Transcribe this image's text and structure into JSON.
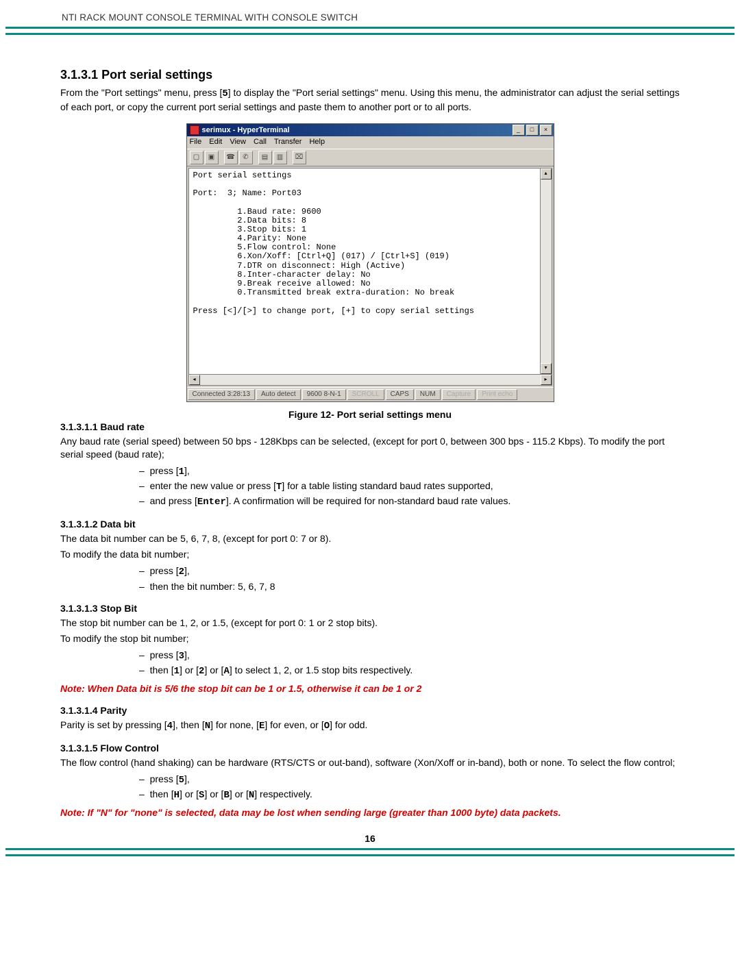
{
  "header": {
    "title": "NTI RACK MOUNT CONSOLE TERMINAL WITH CONSOLE SWITCH"
  },
  "section": {
    "number": "3.1.3.1",
    "title": "Port serial settings",
    "intro_part1": "From the \"Port settings\" menu, press [",
    "intro_key": "5",
    "intro_part2": "] to display the \"Port serial settings\" menu. Using this menu, the administrator can adjust the serial settings of each port, or copy the current port serial settings and paste them to another port or to all ports."
  },
  "hyperterminal": {
    "title": "serimux - HyperTerminal",
    "menubar": [
      "File",
      "Edit",
      "View",
      "Call",
      "Transfer",
      "Help"
    ],
    "terminal_text": "Port serial settings\n\nPort:  3; Name: Port03\n\n         1.Baud rate: 9600\n         2.Data bits: 8\n         3.Stop bits: 1\n         4.Parity: None\n         5.Flow control: None\n         6.Xon/Xoff: [Ctrl+Q] (017) / [Ctrl+S] (019)\n         7.DTR on disconnect: High (Active)\n         8.Inter-character delay: No\n         9.Break receive allowed: No\n         0.Transmitted break extra-duration: No break\n\nPress [<]/[>] to change port, [+] to copy serial settings",
    "status": {
      "connected": "Connected 3:28:13",
      "auto": "Auto detect",
      "settings": "9600 8-N-1",
      "scroll": "SCROLL",
      "caps": "CAPS",
      "num": "NUM",
      "capture": "Capture",
      "printecho": "Print echo"
    }
  },
  "figure_caption": "Figure 12- Port serial settings menu",
  "baud": {
    "heading": "3.1.3.1.1 Baud rate",
    "p1": "Any baud rate (serial speed) between 50 bps - 128Kbps can be selected, (except for port 0,  between 300 bps - 115.2 Kbps). To modify the port serial speed (baud rate);",
    "li1a": "press [",
    "li1key": "1",
    "li1b": "],",
    "li2a": "enter the new value or press [",
    "li2key": "T",
    "li2b": "] for a table listing standard baud rates supported,",
    "li3a": "and press [",
    "li3key": "Enter",
    "li3b": "].    A confirmation will be required for non-standard baud rate values."
  },
  "databit": {
    "heading": "3.1.3.1.2 Data bit",
    "p1": "The data bit number can be 5, 6, 7, 8, (except for port 0:  7 or 8).",
    "p2": "To modify the data bit number;",
    "li1a": "press [",
    "li1key": "2",
    "li1b": "],",
    "li2": "then the bit number: 5, 6, 7, 8"
  },
  "stopbit": {
    "heading": "3.1.3.1.3 Stop Bit",
    "p1": "The stop bit number can be 1, 2, or 1.5, (except for port 0: 1 or 2 stop bits).",
    "p2": "To modify the stop bit number;",
    "li1a": "press [",
    "li1key": "3",
    "li1b": "],",
    "li2a": "then [",
    "li2k1": "1",
    "li2m1": "] or [",
    "li2k2": "2",
    "li2m2": "] or [",
    "li2k3": "A",
    "li2b": "] to select 1, 2, or 1.5 stop bits respectively.",
    "note": "Note: When Data bit is 5/6 the stop bit can be 1 or 1.5,  otherwise  it can be 1 or 2"
  },
  "parity": {
    "heading": "3.1.3.1.4 Parity",
    "p_a": "Parity is set by pressing [",
    "k1": "4",
    "p_b": "], then  [",
    "k2": "N",
    "p_c": "] for none,  [",
    "k3": "E",
    "p_d": "] for even,  or  [",
    "k4": "O",
    "p_e": "] for odd."
  },
  "flow": {
    "heading": "3.1.3.1.5 Flow Control",
    "p1": "The flow control (hand shaking) can be hardware (RTS/CTS or out-band), software (Xon/Xoff or in-band), both or none. To select the flow control;",
    "li1a": "press [",
    "li1key": "5",
    "li1b": "],",
    "li2a": "then [",
    "k1": "H",
    "m1": "] or [",
    "k2": "S",
    "m2": "] or [",
    "k3": "B",
    "m3": "] or [",
    "k4": "N",
    "li2b": "] respectively.",
    "note": "Note: If  \"N\" for \"none\" is selected, data may be lost when sending large (greater than 1000 byte) data packets."
  },
  "page_number": "16"
}
